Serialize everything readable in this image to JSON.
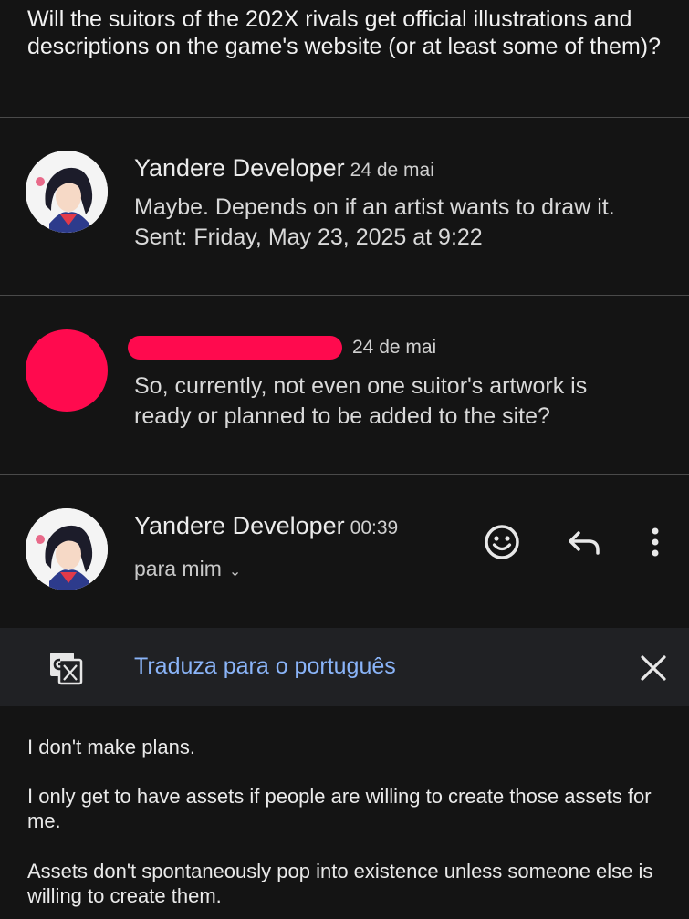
{
  "question": "Will the suitors of the 202X rivals get official illustrations and descriptions on the game's website (or at least some of them)?",
  "messages": [
    {
      "sender": "Yandere Developer",
      "date": "24 de mai",
      "snippet": "Maybe. Depends on if an artist wants to draw it. Sent: Friday, May 23, 2025 at 9:22"
    },
    {
      "sender": "",
      "date": "24 de mai",
      "snippet": "So, currently, not even one suitor's artwork is ready or planned to be added to the site?"
    }
  ],
  "expanded": {
    "sender": "Yandere Developer",
    "time": "00:39",
    "recipient": "para mim",
    "recipient_chevron": "⌄",
    "icons": [
      "emoji-react-icon",
      "reply-icon",
      "more-options-icon"
    ]
  },
  "translate": {
    "link_label": "Traduza para o português"
  },
  "body": [
    "I don't make plans.",
    "I only get to have assets if people are willing to create those assets for me.",
    "Assets don't spontaneously pop into existence unless someone else is willing to create them."
  ],
  "colors": {
    "background": "#141414",
    "translate_bar": "#202124",
    "link": "#8ab4f8",
    "redaction": "#ff0a4e"
  }
}
